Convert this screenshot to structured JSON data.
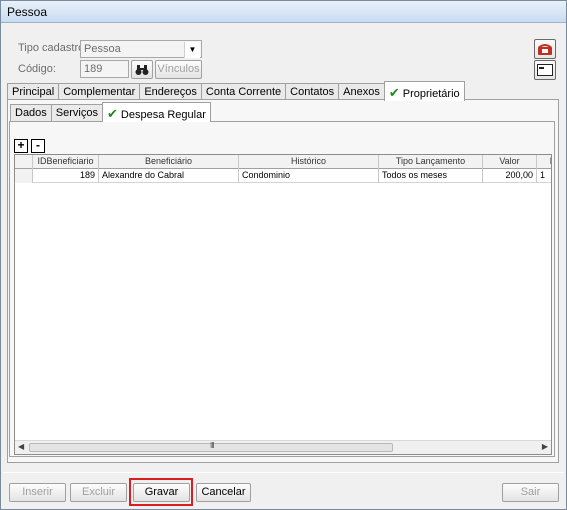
{
  "window": {
    "title": "Pessoa"
  },
  "header": {
    "tipo_cadastro_label": "Tipo cadastro",
    "tipo_cadastro_value": "Pessoa",
    "codigo_label": "Código:",
    "codigo_value": "189",
    "vinculos_label": "Vínculos"
  },
  "tabs": [
    "Principal",
    "Complementar",
    "Endereços",
    "Conta Corrente",
    "Contatos",
    "Anexos",
    "Proprietário"
  ],
  "subtabs": [
    "Dados",
    "Serviços",
    "Despesa Regular"
  ],
  "grid": {
    "add_label": "+",
    "remove_label": "-",
    "columns": [
      "IDBeneficiario",
      "Beneficiário",
      "Histórico",
      "Tipo Lançamento",
      "Valor",
      "Dia"
    ],
    "rows": [
      [
        "189",
        "Alexandre do Cabral",
        "Condominio",
        "Todos os meses",
        "200,00",
        "1"
      ]
    ],
    "scroll_grip": "III"
  },
  "footer": {
    "inserir": "Inserir",
    "excluir": "Excluir",
    "gravar": "Gravar",
    "cancelar": "Cancelar",
    "sair": "Sair"
  },
  "icons": {
    "phone": "telephone-icon",
    "card": "card-icon",
    "binoculars": "binoculars-icon",
    "check": "checkmark-icon"
  },
  "colors": {
    "highlight": "#d81e1e",
    "check": "#1e8a1e"
  }
}
